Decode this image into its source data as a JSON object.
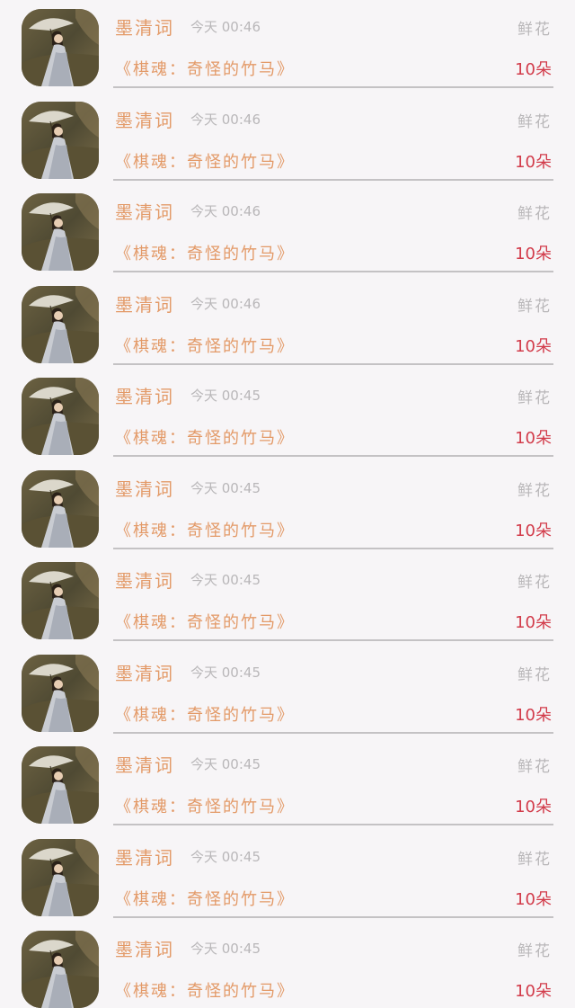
{
  "colors": {
    "background": "#f7f5f7",
    "name": "#e39a68",
    "book_title": "#e39a68",
    "muted": "#b9b7b9",
    "count": "#d23b4a",
    "divider": "#c4c2c4"
  },
  "records": [
    {
      "avatar": "user-avatar-girl-with-umbrella",
      "name": "墨清词",
      "time": "今天 00:46",
      "gift": "鲜花",
      "book": "《棋魂：奇怪的竹马》",
      "count": "10朵"
    },
    {
      "avatar": "user-avatar-girl-with-umbrella",
      "name": "墨清词",
      "time": "今天 00:46",
      "gift": "鲜花",
      "book": "《棋魂：奇怪的竹马》",
      "count": "10朵"
    },
    {
      "avatar": "user-avatar-girl-with-umbrella",
      "name": "墨清词",
      "time": "今天 00:46",
      "gift": "鲜花",
      "book": "《棋魂：奇怪的竹马》",
      "count": "10朵"
    },
    {
      "avatar": "user-avatar-girl-with-umbrella",
      "name": "墨清词",
      "time": "今天 00:46",
      "gift": "鲜花",
      "book": "《棋魂：奇怪的竹马》",
      "count": "10朵"
    },
    {
      "avatar": "user-avatar-girl-with-umbrella",
      "name": "墨清词",
      "time": "今天 00:45",
      "gift": "鲜花",
      "book": "《棋魂：奇怪的竹马》",
      "count": "10朵"
    },
    {
      "avatar": "user-avatar-girl-with-umbrella",
      "name": "墨清词",
      "time": "今天 00:45",
      "gift": "鲜花",
      "book": "《棋魂：奇怪的竹马》",
      "count": "10朵"
    },
    {
      "avatar": "user-avatar-girl-with-umbrella",
      "name": "墨清词",
      "time": "今天 00:45",
      "gift": "鲜花",
      "book": "《棋魂：奇怪的竹马》",
      "count": "10朵"
    },
    {
      "avatar": "user-avatar-girl-with-umbrella",
      "name": "墨清词",
      "time": "今天 00:45",
      "gift": "鲜花",
      "book": "《棋魂：奇怪的竹马》",
      "count": "10朵"
    },
    {
      "avatar": "user-avatar-girl-with-umbrella",
      "name": "墨清词",
      "time": "今天 00:45",
      "gift": "鲜花",
      "book": "《棋魂：奇怪的竹马》",
      "count": "10朵"
    },
    {
      "avatar": "user-avatar-girl-with-umbrella",
      "name": "墨清词",
      "time": "今天 00:45",
      "gift": "鲜花",
      "book": "《棋魂：奇怪的竹马》",
      "count": "10朵"
    },
    {
      "avatar": "user-avatar-girl-with-umbrella",
      "name": "墨清词",
      "time": "今天 00:45",
      "gift": "鲜花",
      "book": "《棋魂：奇怪的竹马》",
      "count": "10朵"
    }
  ]
}
